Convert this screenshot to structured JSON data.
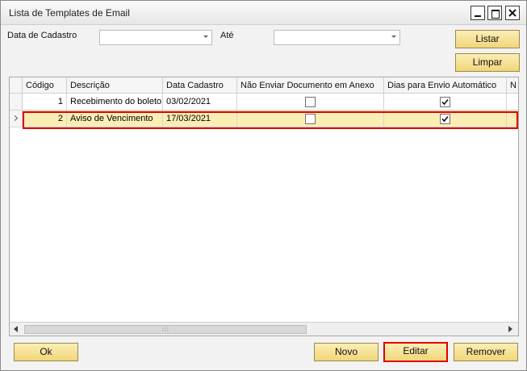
{
  "window": {
    "title": "Lista de Templates de Email"
  },
  "filters": {
    "data_cadastro_label": "Data de Cadastro",
    "data_cadastro_value": "",
    "ate_label": "Até",
    "ate_value": ""
  },
  "buttons": {
    "listar": "Listar",
    "limpar": "Limpar",
    "ok": "Ok",
    "novo": "Novo",
    "editar": "Editar",
    "remover": "Remover"
  },
  "table": {
    "columns": [
      "Código",
      "Descrição",
      "Data Cadastro",
      "Não Enviar Documento em Anexo",
      "Dias para Envio Automático",
      "N"
    ],
    "rows": [
      {
        "codigo": "1",
        "descricao": "Recebimento do boleto",
        "data": "03/02/2021",
        "nao_enviar": false,
        "dias_envio": true,
        "selected": false
      },
      {
        "codigo": "2",
        "descricao": "Aviso de Vencimento",
        "data": "17/03/2021",
        "nao_enviar": false,
        "dias_envio": true,
        "selected": true
      }
    ]
  },
  "colors": {
    "accent": "#f1d67a",
    "highlight": "#e00000",
    "selected_row": "#fbeeb5"
  }
}
